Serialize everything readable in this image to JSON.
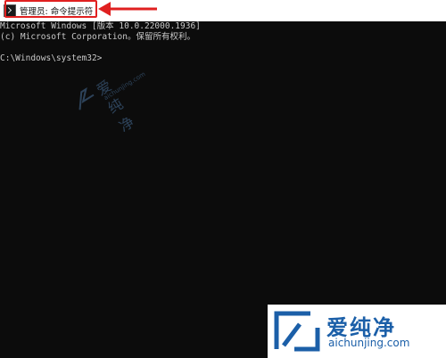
{
  "window": {
    "title": "管理员: 命令提示符"
  },
  "console": {
    "lines": [
      "Microsoft Windows [版本 10.0.22000.1936]",
      "(c) Microsoft Corporation。保留所有权利。",
      "",
      "C:\\Windows\\system32>"
    ]
  },
  "watermark": {
    "brand_cn": "爱纯净",
    "brand_url": "aichunjing.com"
  },
  "colors": {
    "console_bg": "#0c0c0c",
    "console_text": "#c8c8c8",
    "highlight": "#e02020",
    "brand": "#1b5fa8"
  },
  "icons": [
    "cmd-app-icon",
    "annotation-arrow-icon",
    "brand-logo-icon"
  ]
}
